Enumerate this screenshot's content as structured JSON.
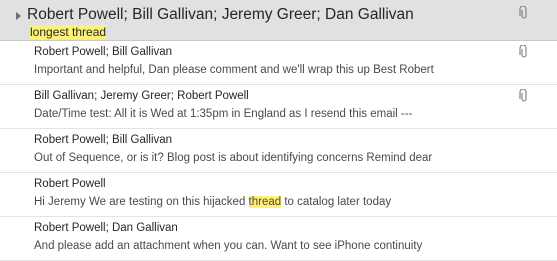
{
  "thread": {
    "participants": "Robert Powell;  Bill Gallivan;  Jeremy Greer;  Dan Gallivan",
    "subject": "longest thread",
    "has_attachment": true
  },
  "messages": [
    {
      "from": "Robert Powell;  Bill Gallivan",
      "preview_before": "Important and helpful,  Dan please comment and we'll wrap this up  Best  Robert",
      "preview_highlight": "",
      "preview_after": "",
      "has_attachment": true
    },
    {
      "from": "Bill Gallivan;  Jeremy Greer;  Robert Powell",
      "preview_before": "Date/Time test:  All it is Wed at 1:35pm in England as I resend this email ---",
      "preview_highlight": "",
      "preview_after": "",
      "has_attachment": true
    },
    {
      "from": "Robert Powell;  Bill Gallivan",
      "preview_before": "Out of Sequence, or is it?  Blog post is about identifying concerns  Remind dear",
      "preview_highlight": "",
      "preview_after": "",
      "has_attachment": false
    },
    {
      "from": "Robert Powell",
      "preview_before": "Hi Jeremy  We are testing on this hijacked ",
      "preview_highlight": "thread",
      "preview_after": " to catalog later today",
      "has_attachment": false
    },
    {
      "from": "Robert Powell;  Dan Gallivan",
      "preview_before": "And please add an attachment when you can.  Want to see iPhone continuity",
      "preview_highlight": "",
      "preview_after": "",
      "has_attachment": false
    }
  ],
  "icons": {
    "expand": "expand-triangle-icon",
    "attachment": "paperclip-icon"
  },
  "colors": {
    "header_bg": "#e1e1e1",
    "highlight": "#fff176",
    "divider": "#e3e3e3"
  }
}
